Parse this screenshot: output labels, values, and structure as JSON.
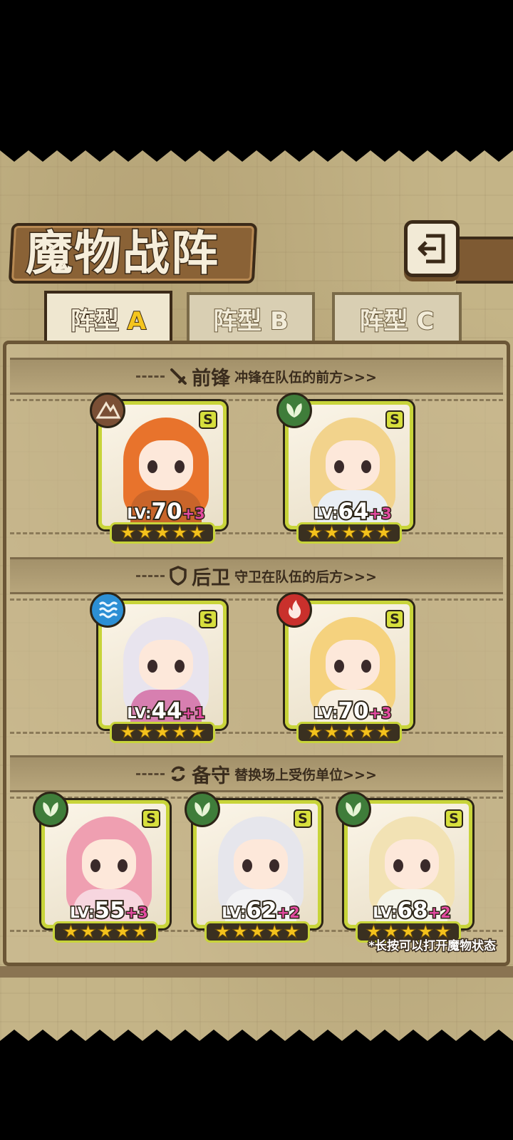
{
  "title": "魔物战阵",
  "back_button": {
    "icon": "return-arrow-icon"
  },
  "tabs": [
    {
      "label": "阵型",
      "letter": "A",
      "active": true
    },
    {
      "label": "阵型",
      "letter": "B",
      "active": false
    },
    {
      "label": "阵型",
      "letter": "C",
      "active": false
    }
  ],
  "sections": {
    "front": {
      "title": "前锋",
      "desc": "冲锋在队伍的前方>>>",
      "icon": "sword-icon"
    },
    "rear": {
      "title": "后卫",
      "desc": "守卫在队伍的后方>>>",
      "icon": "shield-icon"
    },
    "reserve": {
      "title": "备守",
      "desc": "替换场上受伤单位>>>",
      "icon": "swap-icon"
    }
  },
  "units": {
    "front": [
      {
        "level_label": "LV:",
        "level": "70",
        "bonus": "+3",
        "rank": "S",
        "element": "earth",
        "stars": 5
      },
      {
        "level_label": "LV:",
        "level": "64",
        "bonus": "+3",
        "rank": "S",
        "element": "leaf",
        "stars": 5
      }
    ],
    "rear": [
      {
        "level_label": "LV:",
        "level": "44",
        "bonus": "+1",
        "rank": "S",
        "element": "water",
        "stars": 5
      },
      {
        "level_label": "LV:",
        "level": "70",
        "bonus": "+3",
        "rank": "S",
        "element": "fire",
        "stars": 5
      }
    ],
    "reserve": [
      {
        "level_label": "LV:",
        "level": "55",
        "bonus": "+3",
        "rank": "S",
        "element": "leaf",
        "stars": 5
      },
      {
        "level_label": "LV:",
        "level": "62",
        "bonus": "+2",
        "rank": "S",
        "element": "leaf",
        "stars": 5
      },
      {
        "level_label": "LV:",
        "level": "68",
        "bonus": "+2",
        "rank": "S",
        "element": "leaf",
        "stars": 5
      }
    ]
  },
  "hint": "*长按可以打开魔物状态",
  "colors": {
    "parchment": "#c4b487",
    "frame": "#6b5636",
    "card_border": "#c8d43a",
    "star": "#f4c21c",
    "bonus": "#e24aa0"
  }
}
